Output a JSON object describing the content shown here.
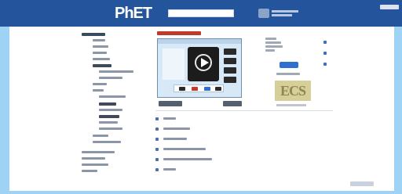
{
  "header": {
    "logo": "PhET"
  },
  "colors": {
    "header_bg": "#24549c",
    "page_bg": "#9ed3f5",
    "accent_red": "#c0392b",
    "button_blue": "#2f6fd0"
  },
  "icons": [
    "search-field",
    "partner-logo",
    "play-icon",
    "bullet-icon"
  ],
  "sim": {
    "badge_logo": "ECS"
  }
}
